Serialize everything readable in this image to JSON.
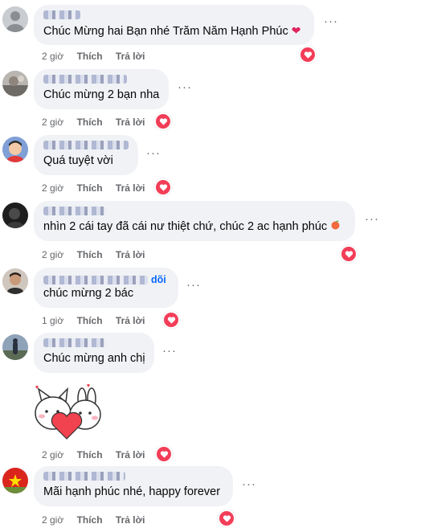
{
  "comments": [
    {
      "text": "Chúc Mừng hai Bạn nhé Trăm Năm Hạnh Phúc",
      "time": "2 giờ",
      "like": "Thích",
      "reply": "Trả lời",
      "emoji": "❤"
    },
    {
      "text": "Chúc mừng 2 bạn nha",
      "time": "2 giờ",
      "like": "Thích",
      "reply": "Trả lời"
    },
    {
      "text": "Quá tuyệt vời",
      "time": "2 giờ",
      "like": "Thích",
      "reply": "Trả lời"
    },
    {
      "text": "nhìn 2 cái tay đã cái nư thiệt chứ, chúc 2 ac hạnh phúc",
      "time": "2 giờ",
      "like": "Thích",
      "reply": "Trả lời"
    },
    {
      "text": "chúc mừng 2 bác",
      "time": "1 giờ",
      "like": "Thích",
      "reply": "Trả lời",
      "follow": "dõi"
    },
    {
      "text": "Chúc mừng anh chị",
      "time": "2 giờ",
      "like": "Thích",
      "reply": "Trả lời"
    },
    {
      "text": "Mãi hạnh phúc nhé, happy forever",
      "time": "2 giờ",
      "like": "Thích",
      "reply": "Trả lời"
    }
  ],
  "more_glyph": "···",
  "colors": {
    "bubble": "#f0f2f5",
    "meta": "#65676b",
    "love": "#f33e58",
    "link": "#0866ff"
  },
  "icons": [
    "more-options-icon",
    "love-reaction-icon",
    "heart-emoji-icon",
    "peach-emoji-icon"
  ]
}
